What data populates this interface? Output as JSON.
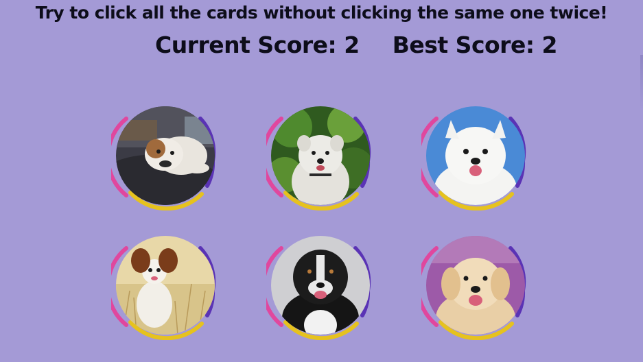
{
  "header": {
    "instructions": "Try to click all the cards without clicking the same one twice!",
    "current_score_label": "Current Score:",
    "current_score": "2",
    "best_score_label": "Best Score:",
    "best_score": "2"
  },
  "colors": {
    "background": "#a49ad6",
    "ring_pink": "#e0479e",
    "ring_purple": "#5a33b5",
    "ring_yellow": "#e6c21e"
  },
  "cards": [
    {
      "icon": "bulldog-photo"
    },
    {
      "icon": "white-terrier-photo"
    },
    {
      "icon": "samoyed-photo"
    },
    {
      "icon": "papillon-photo"
    },
    {
      "icon": "border-collie-photo"
    },
    {
      "icon": "golden-retriever-photo"
    }
  ]
}
